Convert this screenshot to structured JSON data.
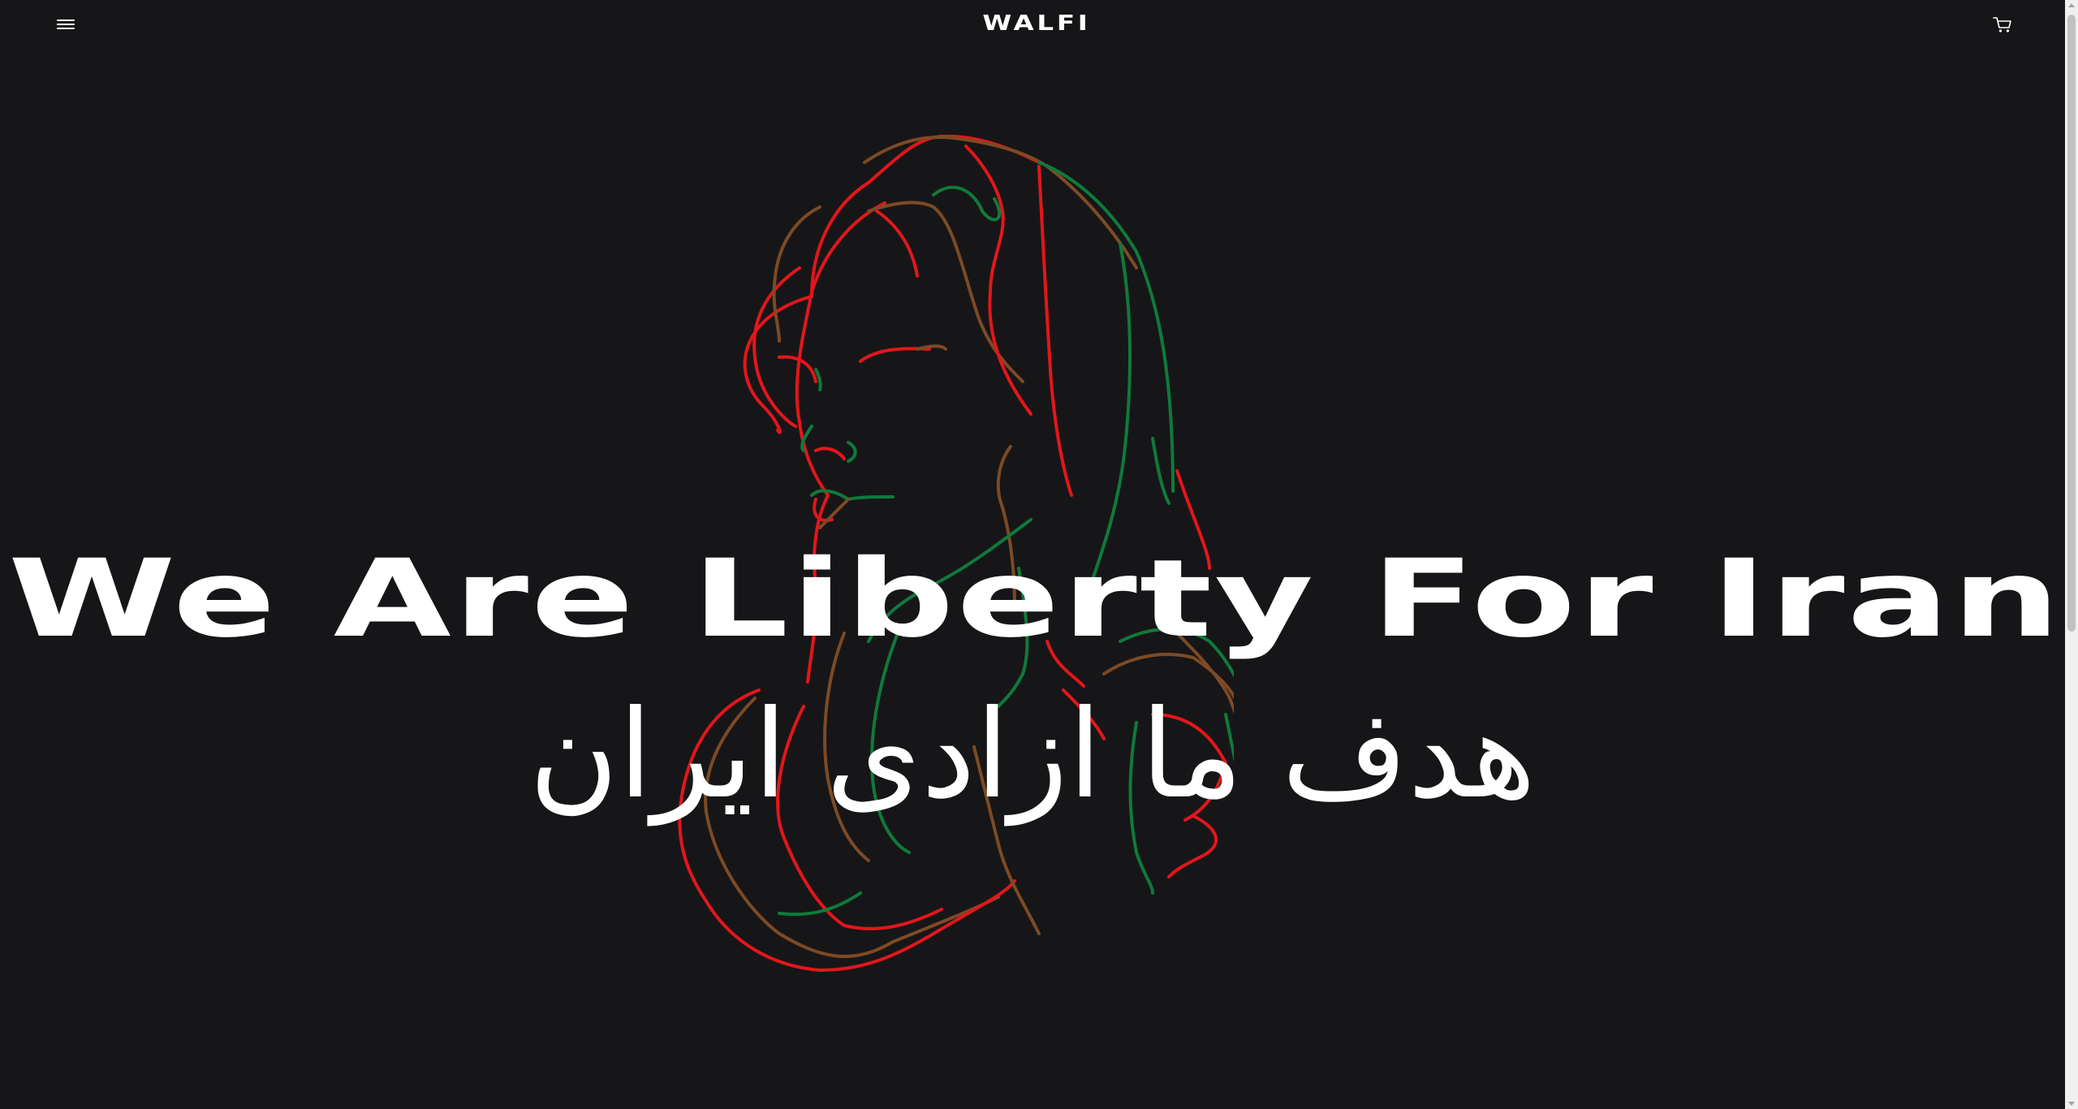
{
  "header": {
    "brand": "WALFI",
    "menu_icon": "hamburger-menu-icon",
    "cart_icon": "shopping-cart-icon"
  },
  "hero": {
    "title": "We Are Liberty For Iran",
    "subtitle": "هدف ما ازادی ایران",
    "illustration": "woman-line-art-illustration"
  },
  "colors": {
    "background": "#161618",
    "text": "#ffffff",
    "line_red": "#e3161b",
    "line_green": "#0f7a3a",
    "line_brown": "#7d4a24"
  }
}
